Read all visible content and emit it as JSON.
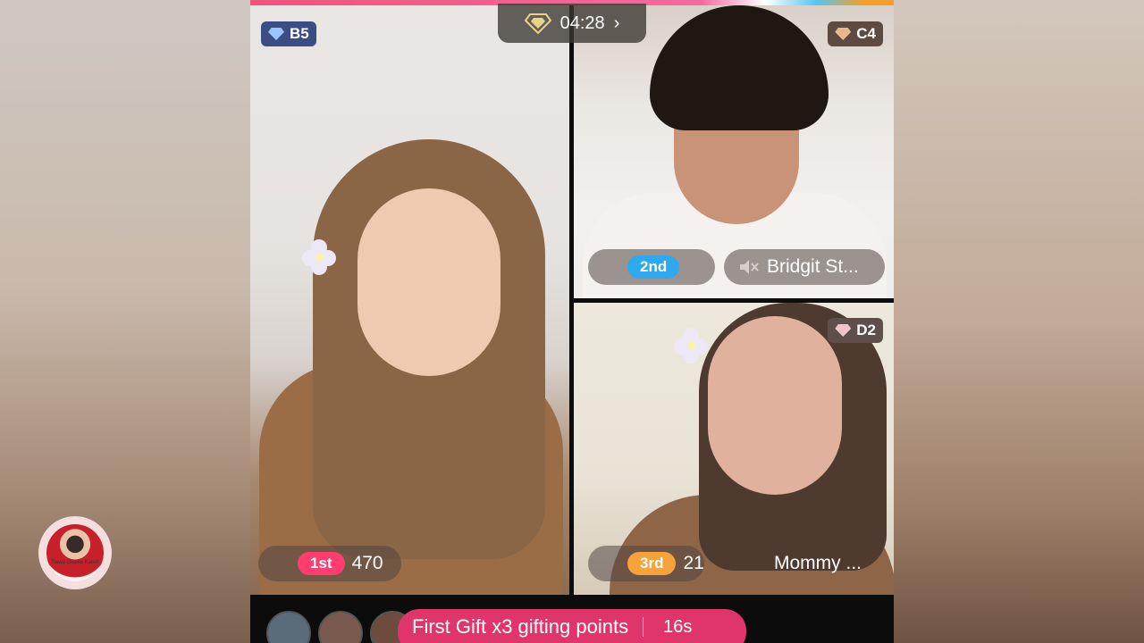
{
  "battle": {
    "timer": "04:28",
    "colors": {
      "accent_pink": "#e0356b",
      "rank1": "#ff3d6e",
      "rank2": "#2ea8ef",
      "rank3": "#f6a33b"
    }
  },
  "host": {
    "avatar_caption": "Tiawa Giselle Kaisin"
  },
  "participants": [
    {
      "badge": "B5",
      "rank_label": "1st",
      "score": "470",
      "name": ""
    },
    {
      "badge": "C4",
      "rank_label": "2nd",
      "score": "",
      "name": "Bridgit St..."
    },
    {
      "badge": "D2",
      "rank_label": "3rd",
      "score": "21",
      "name": "Mommy ..."
    }
  ],
  "gift_banner": {
    "text": "First Gift x3 gifting points",
    "countdown": "16s"
  },
  "icons": [
    "diamond-icon",
    "chevron-right-icon",
    "gem-icon",
    "mute-icon",
    "flower-icon"
  ]
}
